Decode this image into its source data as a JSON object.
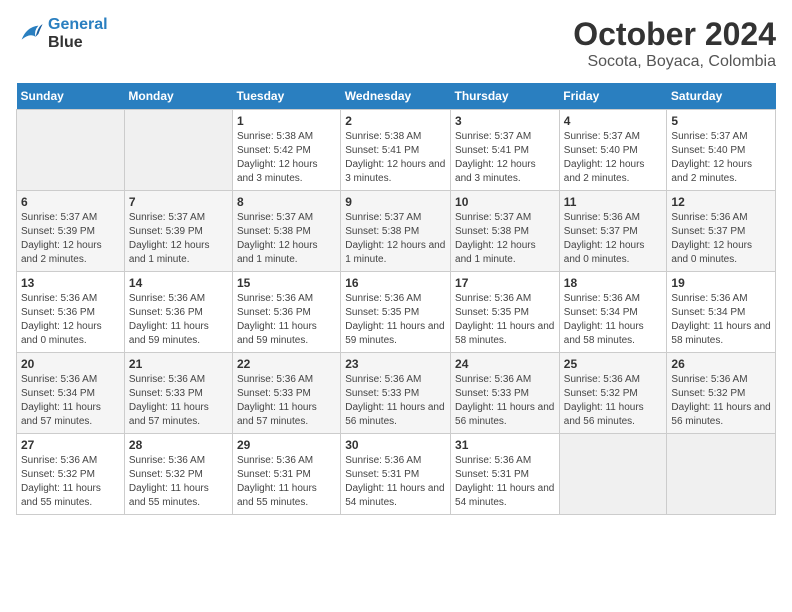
{
  "logo": {
    "line1": "General",
    "line2": "Blue"
  },
  "title": "October 2024",
  "subtitle": "Socota, Boyaca, Colombia",
  "days_header": [
    "Sunday",
    "Monday",
    "Tuesday",
    "Wednesday",
    "Thursday",
    "Friday",
    "Saturday"
  ],
  "weeks": [
    [
      {
        "num": "",
        "info": ""
      },
      {
        "num": "",
        "info": ""
      },
      {
        "num": "1",
        "info": "Sunrise: 5:38 AM\nSunset: 5:42 PM\nDaylight: 12 hours and 3 minutes."
      },
      {
        "num": "2",
        "info": "Sunrise: 5:38 AM\nSunset: 5:41 PM\nDaylight: 12 hours and 3 minutes."
      },
      {
        "num": "3",
        "info": "Sunrise: 5:37 AM\nSunset: 5:41 PM\nDaylight: 12 hours and 3 minutes."
      },
      {
        "num": "4",
        "info": "Sunrise: 5:37 AM\nSunset: 5:40 PM\nDaylight: 12 hours and 2 minutes."
      },
      {
        "num": "5",
        "info": "Sunrise: 5:37 AM\nSunset: 5:40 PM\nDaylight: 12 hours and 2 minutes."
      }
    ],
    [
      {
        "num": "6",
        "info": "Sunrise: 5:37 AM\nSunset: 5:39 PM\nDaylight: 12 hours and 2 minutes."
      },
      {
        "num": "7",
        "info": "Sunrise: 5:37 AM\nSunset: 5:39 PM\nDaylight: 12 hours and 1 minute."
      },
      {
        "num": "8",
        "info": "Sunrise: 5:37 AM\nSunset: 5:38 PM\nDaylight: 12 hours and 1 minute."
      },
      {
        "num": "9",
        "info": "Sunrise: 5:37 AM\nSunset: 5:38 PM\nDaylight: 12 hours and 1 minute."
      },
      {
        "num": "10",
        "info": "Sunrise: 5:37 AM\nSunset: 5:38 PM\nDaylight: 12 hours and 1 minute."
      },
      {
        "num": "11",
        "info": "Sunrise: 5:36 AM\nSunset: 5:37 PM\nDaylight: 12 hours and 0 minutes."
      },
      {
        "num": "12",
        "info": "Sunrise: 5:36 AM\nSunset: 5:37 PM\nDaylight: 12 hours and 0 minutes."
      }
    ],
    [
      {
        "num": "13",
        "info": "Sunrise: 5:36 AM\nSunset: 5:36 PM\nDaylight: 12 hours and 0 minutes."
      },
      {
        "num": "14",
        "info": "Sunrise: 5:36 AM\nSunset: 5:36 PM\nDaylight: 11 hours and 59 minutes."
      },
      {
        "num": "15",
        "info": "Sunrise: 5:36 AM\nSunset: 5:36 PM\nDaylight: 11 hours and 59 minutes."
      },
      {
        "num": "16",
        "info": "Sunrise: 5:36 AM\nSunset: 5:35 PM\nDaylight: 11 hours and 59 minutes."
      },
      {
        "num": "17",
        "info": "Sunrise: 5:36 AM\nSunset: 5:35 PM\nDaylight: 11 hours and 58 minutes."
      },
      {
        "num": "18",
        "info": "Sunrise: 5:36 AM\nSunset: 5:34 PM\nDaylight: 11 hours and 58 minutes."
      },
      {
        "num": "19",
        "info": "Sunrise: 5:36 AM\nSunset: 5:34 PM\nDaylight: 11 hours and 58 minutes."
      }
    ],
    [
      {
        "num": "20",
        "info": "Sunrise: 5:36 AM\nSunset: 5:34 PM\nDaylight: 11 hours and 57 minutes."
      },
      {
        "num": "21",
        "info": "Sunrise: 5:36 AM\nSunset: 5:33 PM\nDaylight: 11 hours and 57 minutes."
      },
      {
        "num": "22",
        "info": "Sunrise: 5:36 AM\nSunset: 5:33 PM\nDaylight: 11 hours and 57 minutes."
      },
      {
        "num": "23",
        "info": "Sunrise: 5:36 AM\nSunset: 5:33 PM\nDaylight: 11 hours and 56 minutes."
      },
      {
        "num": "24",
        "info": "Sunrise: 5:36 AM\nSunset: 5:33 PM\nDaylight: 11 hours and 56 minutes."
      },
      {
        "num": "25",
        "info": "Sunrise: 5:36 AM\nSunset: 5:32 PM\nDaylight: 11 hours and 56 minutes."
      },
      {
        "num": "26",
        "info": "Sunrise: 5:36 AM\nSunset: 5:32 PM\nDaylight: 11 hours and 56 minutes."
      }
    ],
    [
      {
        "num": "27",
        "info": "Sunrise: 5:36 AM\nSunset: 5:32 PM\nDaylight: 11 hours and 55 minutes."
      },
      {
        "num": "28",
        "info": "Sunrise: 5:36 AM\nSunset: 5:32 PM\nDaylight: 11 hours and 55 minutes."
      },
      {
        "num": "29",
        "info": "Sunrise: 5:36 AM\nSunset: 5:31 PM\nDaylight: 11 hours and 55 minutes."
      },
      {
        "num": "30",
        "info": "Sunrise: 5:36 AM\nSunset: 5:31 PM\nDaylight: 11 hours and 54 minutes."
      },
      {
        "num": "31",
        "info": "Sunrise: 5:36 AM\nSunset: 5:31 PM\nDaylight: 11 hours and 54 minutes."
      },
      {
        "num": "",
        "info": ""
      },
      {
        "num": "",
        "info": ""
      }
    ]
  ]
}
